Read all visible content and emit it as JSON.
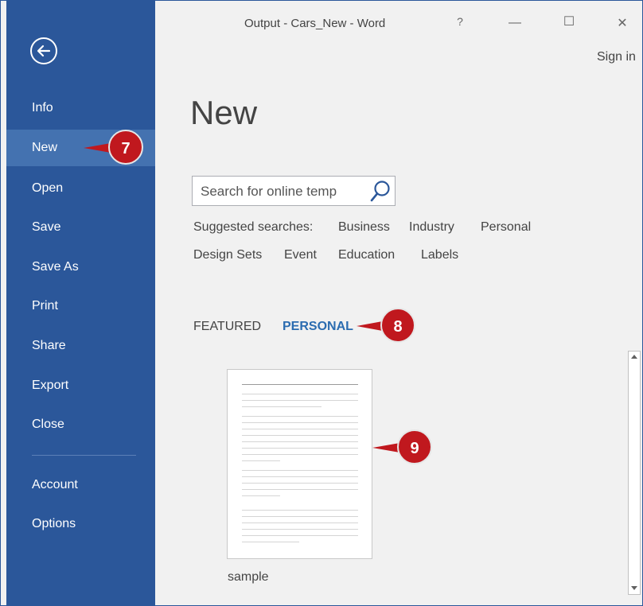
{
  "window": {
    "title": "Output - Cars_New - Word",
    "help": "?",
    "minimize": "—",
    "maximize": "☐",
    "close": "✕",
    "sign_in": "Sign in"
  },
  "sidebar": {
    "items": [
      {
        "label": "Info"
      },
      {
        "label": "New",
        "selected": true
      },
      {
        "label": "Open"
      },
      {
        "label": "Save"
      },
      {
        "label": "Save As"
      },
      {
        "label": "Print"
      },
      {
        "label": "Share"
      },
      {
        "label": "Export"
      },
      {
        "label": "Close"
      },
      {
        "label": "Account"
      },
      {
        "label": "Options"
      }
    ]
  },
  "main": {
    "heading": "New",
    "search": {
      "placeholder": "Search for online temp"
    },
    "suggested": {
      "label": "Suggested searches:",
      "items": [
        "Business",
        "Industry",
        "Personal",
        "Design Sets",
        "Event",
        "Education",
        "Labels"
      ]
    },
    "tabs": [
      {
        "label": "FEATURED",
        "active": false
      },
      {
        "label": "PERSONAL",
        "active": true
      }
    ],
    "templates": [
      {
        "label": "sample"
      }
    ]
  },
  "callouts": [
    "7",
    "8",
    "9"
  ],
  "colors": {
    "sidebar_bg": "#2b579a",
    "sidebar_selected": "#4472b0",
    "accent_tab": "#2b6cb0",
    "callout": "#c0181e"
  }
}
